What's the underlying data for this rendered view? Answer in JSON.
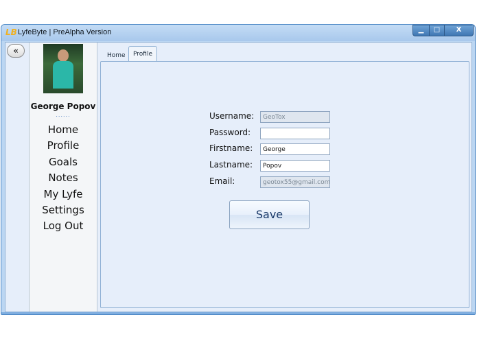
{
  "window": {
    "title": "LyfeByte | PreAlpha Version",
    "logo_text": "LB",
    "controls": {
      "minimize": "▁",
      "maximize": "□",
      "close": "X"
    }
  },
  "sidebar": {
    "collapse_label": "«",
    "user_name": "George Popov",
    "dots": "......",
    "nav": [
      "Home",
      "Profile",
      "Goals",
      "Notes",
      "My Lyfe",
      "Settings",
      "Log Out"
    ]
  },
  "tabs": [
    "Home",
    "Profile"
  ],
  "form": {
    "username_label": "Username:",
    "username_value": "GeoTox",
    "password_label": "Password:",
    "password_value": "",
    "firstname_label": "Firstname:",
    "firstname_value": "George",
    "lastname_label": "Lastname:",
    "lastname_value": "Popov",
    "email_label": "Email:",
    "email_value": "geotox55@gmail.com",
    "save_label": "Save"
  }
}
